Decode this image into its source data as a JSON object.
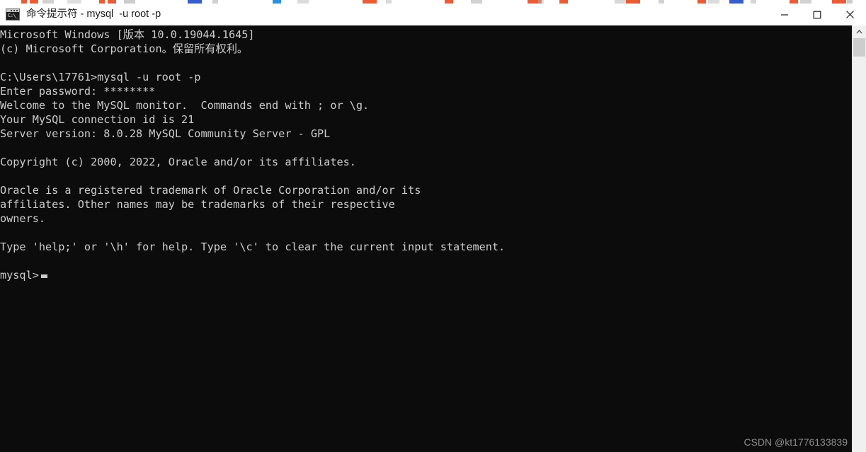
{
  "window": {
    "title": "命令提示符 - mysql  -u root -p",
    "icon": "cmd-prompt-icon",
    "icon_glyph": "C:\\_",
    "controls": {
      "minimize": "minimize-button",
      "maximize": "maximize-button",
      "close": "close-button"
    }
  },
  "terminal": {
    "background_color": "#0c0c0c",
    "foreground_color": "#cccccc",
    "cursor": "block-cursor",
    "lines": [
      "Microsoft Windows [版本 10.0.19044.1645]",
      "(c) Microsoft Corporation。保留所有权利。",
      "",
      "C:\\Users\\17761>mysql -u root -p",
      "Enter password: ********",
      "Welcome to the MySQL monitor.  Commands end with ; or \\g.",
      "Your MySQL connection id is 21",
      "Server version: 8.0.28 MySQL Community Server - GPL",
      "",
      "Copyright (c) 2000, 2022, Oracle and/or its affiliates.",
      "",
      "Oracle is a registered trademark of Oracle Corporation and/or its",
      "affiliates. Other names may be trademarks of their respective",
      "owners.",
      "",
      "Type 'help;' or '\\h' for help. Type '\\c' to clear the current input statement.",
      "",
      "mysql>"
    ],
    "prompt": "mysql>"
  },
  "watermark": {
    "text": "CSDN @kt1776133839"
  },
  "background": {
    "scrollbar": "vertical-scrollbar",
    "scroll_up_arrow": "scroll-up-arrow"
  }
}
